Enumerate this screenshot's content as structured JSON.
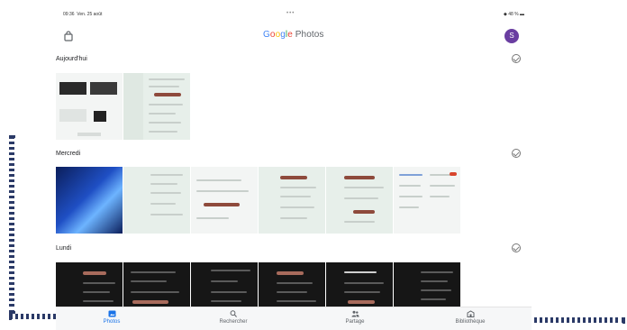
{
  "status_bar": {
    "time": "09:36",
    "date": "Ven. 25 août",
    "center": "•••",
    "battery": "48 %"
  },
  "header": {
    "logo": {
      "g1": "G",
      "g2": "o",
      "g3": "o",
      "g4": "g",
      "g5": "l",
      "g6": "e",
      "rest": " Photos"
    },
    "avatar_initial": "S"
  },
  "sections": [
    {
      "title": "Aujourd'hui"
    },
    {
      "title": "Mercredi"
    },
    {
      "title": "Lundi"
    }
  ],
  "bottom_nav": {
    "photos": "Photos",
    "search": "Rechercher",
    "sharing": "Partage",
    "library": "Bibliothèque",
    "active": "Photos"
  },
  "colors": {
    "accent": "#1a73e8",
    "avatar": "#6a3ea1",
    "button": "#8e4a3c",
    "callout": "#1c2b5a"
  }
}
